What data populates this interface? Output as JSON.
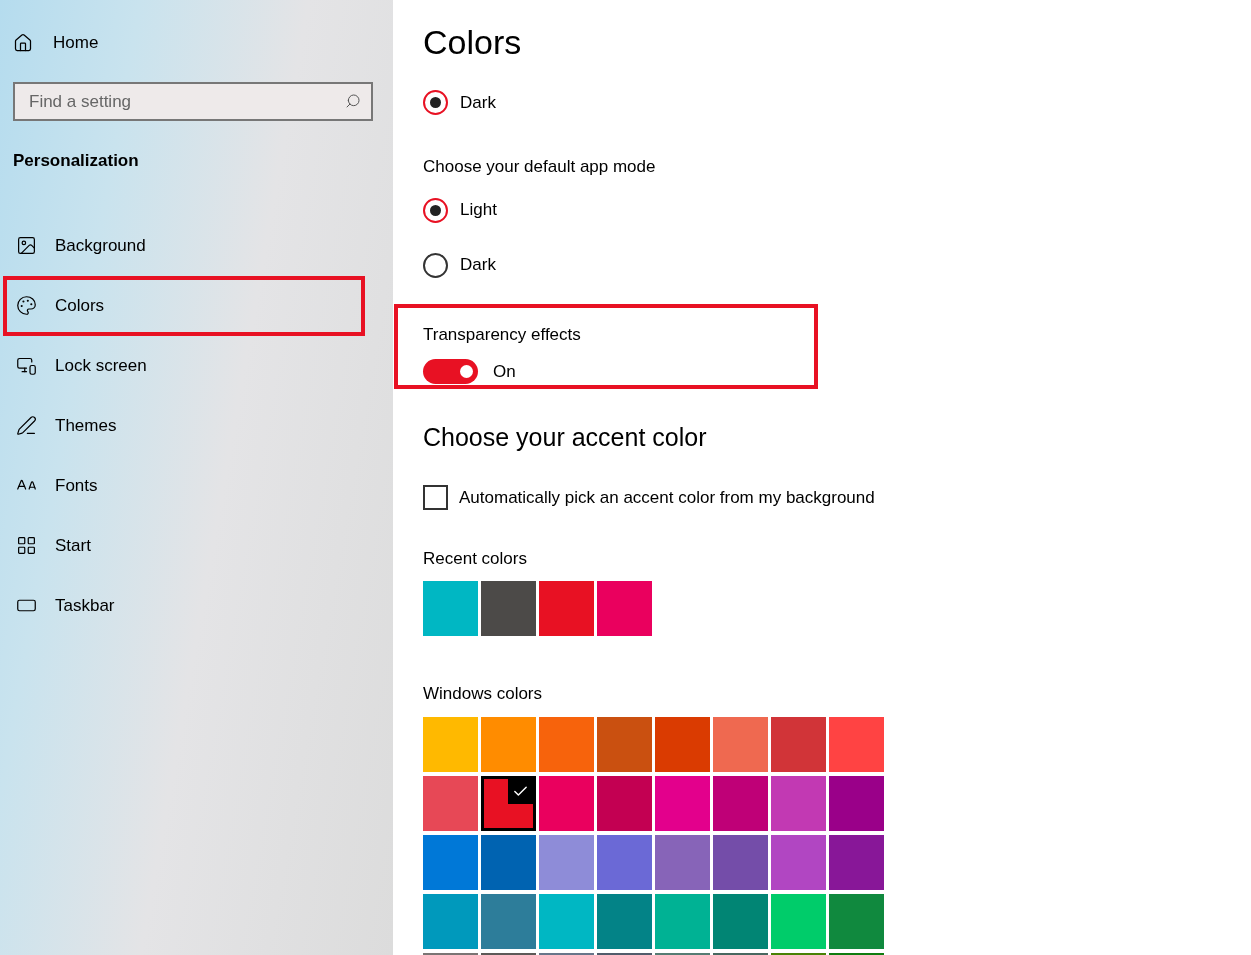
{
  "sidebar": {
    "home": "Home",
    "search": {
      "placeholder": "Find a setting"
    },
    "section": "Personalization",
    "items": [
      {
        "label": "Background",
        "highlighted": false
      },
      {
        "label": "Colors",
        "highlighted": true
      },
      {
        "label": "Lock screen",
        "highlighted": false
      },
      {
        "label": "Themes",
        "highlighted": false
      },
      {
        "label": "Fonts",
        "highlighted": false
      },
      {
        "label": "Start",
        "highlighted": false
      },
      {
        "label": "Taskbar",
        "highlighted": false
      }
    ]
  },
  "main": {
    "title": "Colors",
    "windows_mode": [
      {
        "label": "Dark",
        "selected": true
      }
    ],
    "app_mode": {
      "label": "Choose your default app mode",
      "options": [
        {
          "label": "Light",
          "selected": true
        },
        {
          "label": "Dark",
          "selected": false
        }
      ]
    },
    "transparency": {
      "label": "Transparency effects",
      "on": true,
      "state": "On",
      "highlighted": true
    },
    "accent": {
      "heading": "Choose your accent color",
      "auto": {
        "label": "Automatically pick an accent color from my background",
        "checked": false
      },
      "recent_label": "Recent colors",
      "recent": [
        {
          "color": "#00b7c3"
        },
        {
          "color": "#4c4a48"
        },
        {
          "color": "#e81123"
        },
        {
          "color": "#ea005e"
        }
      ],
      "windows_label": "Windows colors",
      "windows": [
        [
          {
            "color": "#ffb900",
            "selected": false
          },
          {
            "color": "#ff8c00",
            "selected": false
          },
          {
            "color": "#f7630c",
            "selected": false
          },
          {
            "color": "#ca5010",
            "selected": false
          },
          {
            "color": "#da3b01",
            "selected": false
          },
          {
            "color": "#ef6950",
            "selected": false
          },
          {
            "color": "#d13438",
            "selected": false
          },
          {
            "color": "#ff4343",
            "selected": false
          }
        ],
        [
          {
            "color": "#e74856",
            "selected": false
          },
          {
            "color": "#e81123",
            "selected": true
          },
          {
            "color": "#ea005e",
            "selected": false
          },
          {
            "color": "#c30052",
            "selected": false
          },
          {
            "color": "#e3008c",
            "selected": false
          },
          {
            "color": "#bf0077",
            "selected": false
          },
          {
            "color": "#c239b3",
            "selected": false
          },
          {
            "color": "#9a0089",
            "selected": false
          }
        ],
        [
          {
            "color": "#0078d7",
            "selected": false
          },
          {
            "color": "#0063b1",
            "selected": false
          },
          {
            "color": "#8e8cd8",
            "selected": false
          },
          {
            "color": "#6b69d6",
            "selected": false
          },
          {
            "color": "#8764b8",
            "selected": false
          },
          {
            "color": "#744da9",
            "selected": false
          },
          {
            "color": "#b146c2",
            "selected": false
          },
          {
            "color": "#881798",
            "selected": false
          }
        ],
        [
          {
            "color": "#0099bc",
            "selected": false
          },
          {
            "color": "#2d7d9a",
            "selected": false
          },
          {
            "color": "#00b7c3",
            "selected": false
          },
          {
            "color": "#038387",
            "selected": false
          },
          {
            "color": "#00b294",
            "selected": false
          },
          {
            "color": "#018574",
            "selected": false
          },
          {
            "color": "#00cc6a",
            "selected": false
          },
          {
            "color": "#10893e",
            "selected": false
          }
        ],
        [
          {
            "color": "#7a7574",
            "selected": false
          },
          {
            "color": "#5d5a58",
            "selected": false
          },
          {
            "color": "#68768a",
            "selected": false
          },
          {
            "color": "#515c6b",
            "selected": false
          },
          {
            "color": "#567c73",
            "selected": false
          },
          {
            "color": "#486860",
            "selected": false
          },
          {
            "color": "#498205",
            "selected": false
          },
          {
            "color": "#107c10",
            "selected": false
          }
        ]
      ]
    }
  }
}
